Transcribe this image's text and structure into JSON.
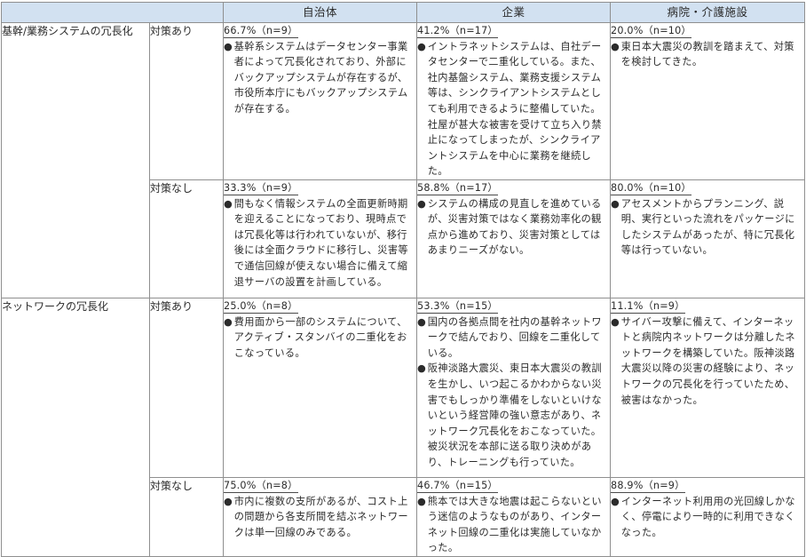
{
  "columns": [
    "自治体",
    "企業",
    "病院・介護施設"
  ],
  "bullet_glyph": "●",
  "categories": [
    {
      "label": "基幹/業務システムの冗長化",
      "rows": [
        {
          "label": "対策あり",
          "cells": [
            {
              "stat": "66.7%（n=9）",
              "items": [
                "基幹系システムはデータセンター事業者によって冗長化されており、外部にバックアップシステムが存在するが、市役所本庁にもバックアップシステムが存在する。"
              ]
            },
            {
              "stat": "41.2%（n=17）",
              "items": [
                "イントラネットシステムは、自社データセンターで二重化している。また、社内基盤システム、業務支援システム等は、シンクライアントシステムとしても利用できるように整備していた。社屋が甚大な被害を受けて立ち入り禁止になってしまったが、シンクライアントシステムを中心に業務を継続した。"
              ]
            },
            {
              "stat": "20.0%（n=10）",
              "items": [
                "東日本大震災の教訓を踏まえて、対策を検討してきた。"
              ]
            }
          ]
        },
        {
          "label": "対策なし",
          "cells": [
            {
              "stat": "33.3%（n=9）",
              "items": [
                "間もなく情報システムの全面更新時期を迎えることになっており、現時点では冗長化等は行われていないが、移行後には全面クラウドに移行し、災害等で通信回線が使えない場合に備えて縮退サーバの設置を計画している。"
              ]
            },
            {
              "stat": "58.8%（n=17）",
              "items": [
                "システムの構成の見直しを進めているが、災害対策ではなく業務効率化の観点から進めており、災害対策としてはあまりニーズがない。"
              ]
            },
            {
              "stat": "80.0%（n=10）",
              "items": [
                "アセスメントからプランニング、説明、実行といった流れをパッケージにしたシステムがあったが、特に冗長化等は行っていない。"
              ]
            }
          ]
        }
      ]
    },
    {
      "label": "ネットワークの冗長化",
      "rows": [
        {
          "label": "対策あり",
          "cells": [
            {
              "stat": "25.0%（n=8）",
              "items": [
                "費用面から一部のシステムについて、アクティブ・スタンバイの二重化をおこなっている。"
              ]
            },
            {
              "stat": "53.3%（n=15）",
              "items": [
                "国内の各拠点間を社内の基幹ネットワークで結んでおり、回線を二重化している。",
                "阪神淡路大震災、東日本大震災の教訓を生かし、いつ起こるかわからない災害でもしっかり準備をしないといけないという経営陣の強い意志があり、ネットワーク冗長化をおこなっていた。被災状況を本部に送る取り決めがあり、トレーニングも行っていた。"
              ]
            },
            {
              "stat": "11.1%（n=9）",
              "items": [
                "サイバー攻撃に備えて、インターネットと病院内ネットワークは分離したネットワークを構築していた。阪神淡路大震災以降の災害の経験により、ネットワークの冗長化を行っていたため、被害はなかった。"
              ]
            }
          ]
        },
        {
          "label": "対策なし",
          "cells": [
            {
              "stat": "75.0%（n=8）",
              "items": [
                "市内に複数の支所があるが、コスト上の問題から各支所間を結ぶネットワークは単一回線のみである。"
              ]
            },
            {
              "stat": "46.7%（n=15）",
              "items": [
                "熊本では大きな地震は起こらないという迷信のようなものがあり、インターネット回線の二重化は実施していなかった。"
              ]
            },
            {
              "stat": "88.9%（n=9）",
              "items": [
                "インターネット利用用の光回線しかなく、停電により一時的に利用できなくなった。"
              ]
            }
          ]
        }
      ]
    }
  ]
}
